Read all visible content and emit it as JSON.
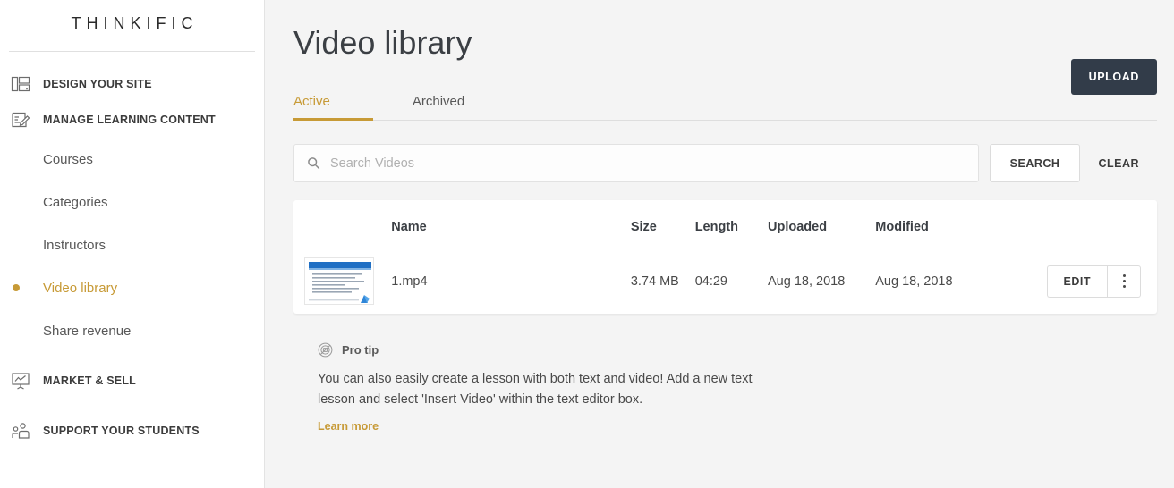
{
  "sidebar": {
    "brand": "THINKIFIC",
    "groups": [
      {
        "label": "DESIGN YOUR SITE",
        "icon": "layout-icon"
      },
      {
        "label": "MANAGE LEARNING CONTENT",
        "icon": "edit-document-icon"
      },
      {
        "label": "MARKET & SELL",
        "icon": "chart-presentation-icon"
      },
      {
        "label": "SUPPORT YOUR STUDENTS",
        "icon": "people-icon"
      }
    ],
    "sub_items": [
      {
        "label": "Courses",
        "active": false
      },
      {
        "label": "Categories",
        "active": false
      },
      {
        "label": "Instructors",
        "active": false
      },
      {
        "label": "Video library",
        "active": true
      },
      {
        "label": "Share revenue",
        "active": false
      }
    ],
    "active_color": "#c79a36"
  },
  "main": {
    "title": "Video library",
    "tabs": [
      {
        "label": "Active",
        "active": true
      },
      {
        "label": "Archived",
        "active": false
      }
    ],
    "upload_label": "UPLOAD",
    "search": {
      "placeholder": "Search Videos",
      "value": "",
      "search_label": "SEARCH",
      "clear_label": "CLEAR",
      "icon": "search-icon"
    },
    "table": {
      "columns": [
        "",
        "Name",
        "Size",
        "Length",
        "Uploaded",
        "Modified",
        ""
      ],
      "rows": [
        {
          "thumbnail": "video-thumbnail",
          "name": "1.mp4",
          "size": "3.74 MB",
          "length": "04:29",
          "uploaded": "Aug 18, 2018",
          "modified": "Aug 18, 2018",
          "edit_label": "EDIT",
          "more_label": "more-options"
        }
      ]
    },
    "protip": {
      "icon": "lightbulb-circle-icon",
      "title": "Pro tip",
      "body": "You can also easily create a lesson with both text and video! Add a new text lesson and select 'Insert Video' within the text editor box.",
      "link_label": "Learn more"
    }
  },
  "colors": {
    "accent": "#c79a36",
    "upload_button": "#323c49",
    "page_background": "#f4f4f4",
    "sidebar_background": "#ffffff"
  }
}
